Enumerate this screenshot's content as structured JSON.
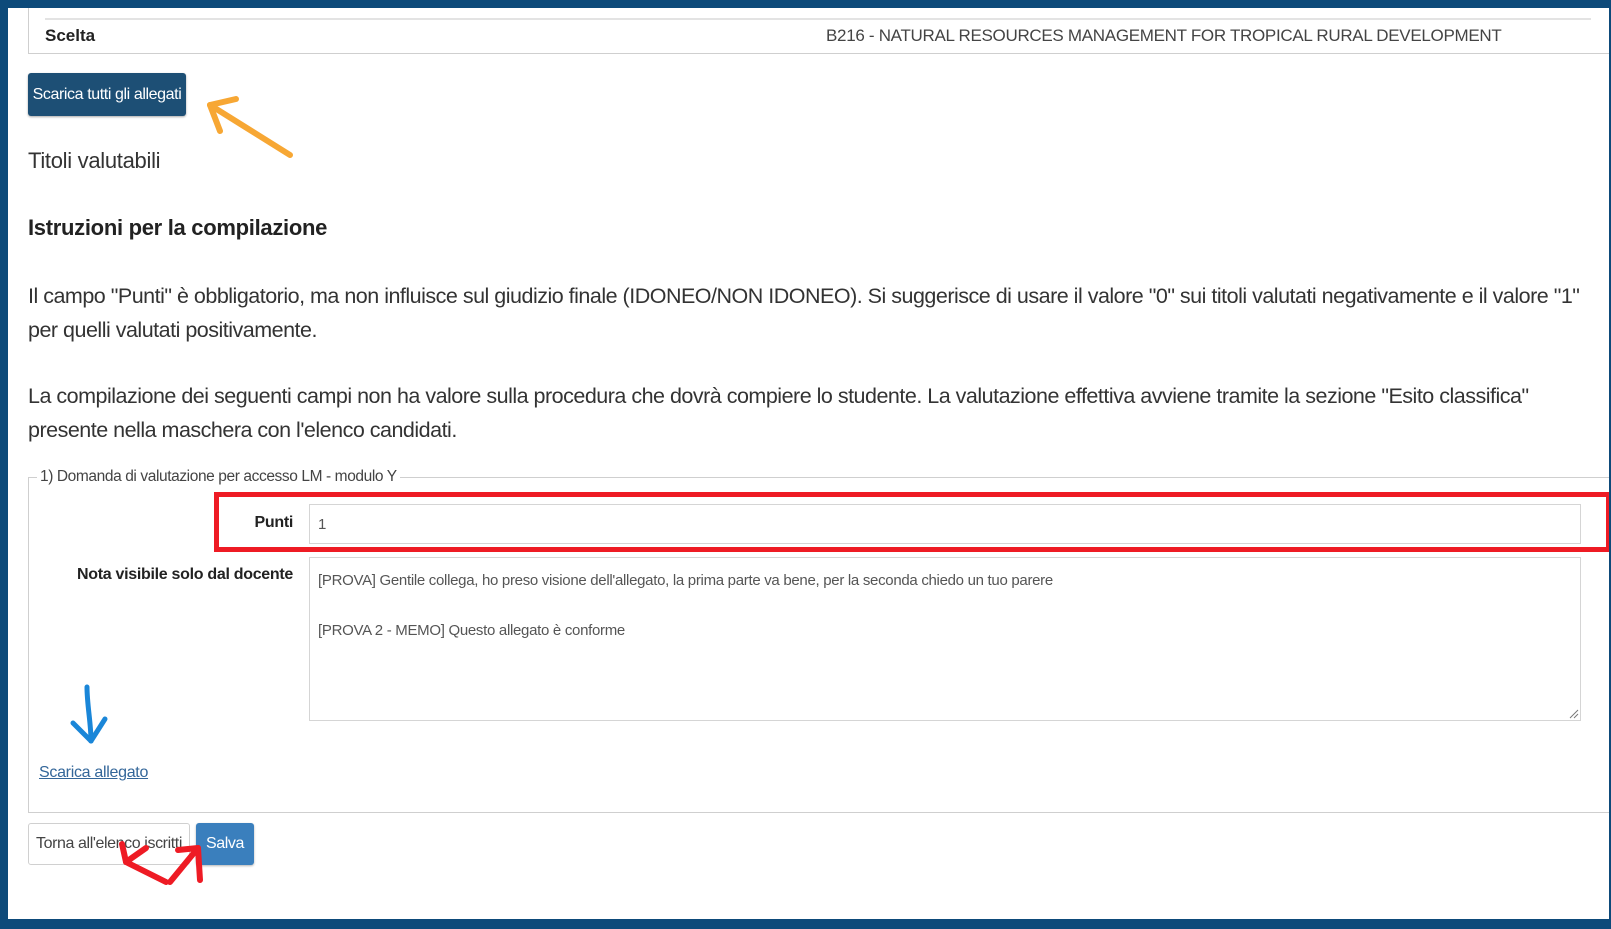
{
  "header": {
    "scelta_label": "Scelta",
    "scelta_value": "B216 - NATURAL RESOURCES MANAGEMENT FOR TROPICAL RURAL DEVELOPMENT"
  },
  "actions": {
    "download_all_label": "Scarica tutti gli allegati"
  },
  "section": {
    "title": "Titoli valutabili",
    "instructions_heading": "Istruzioni per la compilazione",
    "paragraph_1": "Il campo \"Punti\" è obbligatorio, ma non influisce sul giudizio finale (IDONEO/NON IDONEO). Si suggerisce di usare il valore \"0\" sui titoli valutati negativamente e il valore \"1\" per quelli valutati positivamente.",
    "paragraph_2": "La compilazione dei seguenti campi non ha valore sulla procedura che dovrà compiere lo studente. La valutazione effettiva avviene tramite la sezione \"Esito classifica\" presente nella maschera con l'elenco candidati."
  },
  "form": {
    "legend": "1) Domanda di valutazione per accesso LM - modulo Y",
    "punti_label": "Punti",
    "punti_value": "1",
    "nota_label": "Nota visibile solo dal docente",
    "nota_value": "[PROVA] Gentile collega, ho preso visione dell'allegato, la prima parte va bene, per la seconda chiedo un tuo parere\n\n[PROVA 2 - MEMO] Questo allegato è conforme",
    "download_link": "Scarica allegato"
  },
  "footer": {
    "back_label": "Torna all'elenco iscritti",
    "save_label": "Salva"
  },
  "annotations": {
    "orange_arrow_color": "#f7a734",
    "blue_arrow_color": "#1a86d8",
    "red_color": "#ee1b24"
  },
  "theme": {
    "frame_color": "#0d4a7a",
    "primary_button": "#1d4f75",
    "save_button": "#3a7fbd",
    "link_color": "#336699"
  }
}
